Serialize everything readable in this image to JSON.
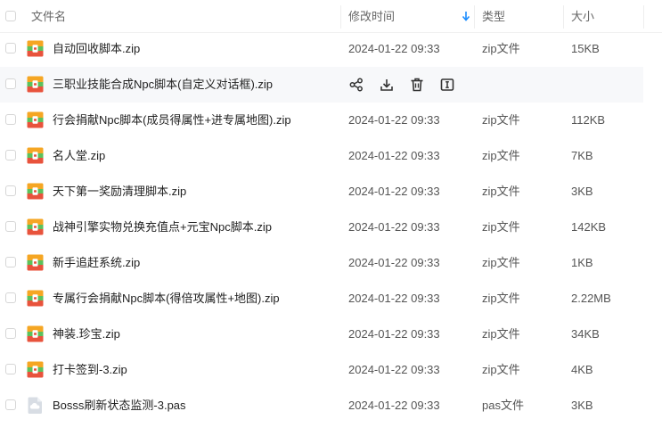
{
  "header": {
    "name_label": "文件名",
    "time_label": "修改时间",
    "type_label": "类型",
    "size_label": "大小"
  },
  "colors": {
    "accent": "#1a8cff",
    "zip_orange": "#f5a623",
    "zip_green": "#5cc15c",
    "zip_red": "#e8533c",
    "generic_gray": "#d8dde4"
  },
  "files": [
    {
      "name": "自动回收脚本.zip",
      "time": "2024-01-22 09:33",
      "type": "zip文件",
      "size": "15KB",
      "icon": "zip-file-icon"
    },
    {
      "name": "三职业技能合成Npc脚本(自定义对话框).zip",
      "time": "",
      "type": "",
      "size": "",
      "icon": "zip-file-icon",
      "hovered": true
    },
    {
      "name": "行会捐献Npc脚本(成员得属性+进专属地图).zip",
      "time": "2024-01-22 09:33",
      "type": "zip文件",
      "size": "112KB",
      "icon": "zip-file-icon"
    },
    {
      "name": "名人堂.zip",
      "time": "2024-01-22 09:33",
      "type": "zip文件",
      "size": "7KB",
      "icon": "zip-file-icon"
    },
    {
      "name": "天下第一奖励清理脚本.zip",
      "time": "2024-01-22 09:33",
      "type": "zip文件",
      "size": "3KB",
      "icon": "zip-file-icon"
    },
    {
      "name": "战神引擎实物兑换充值点+元宝Npc脚本.zip",
      "time": "2024-01-22 09:33",
      "type": "zip文件",
      "size": "142KB",
      "icon": "zip-file-icon"
    },
    {
      "name": "新手追赶系统.zip",
      "time": "2024-01-22 09:33",
      "type": "zip文件",
      "size": "1KB",
      "icon": "zip-file-icon"
    },
    {
      "name": "专属行会捐献Npc脚本(得倍攻属性+地图).zip",
      "time": "2024-01-22 09:33",
      "type": "zip文件",
      "size": "2.22MB",
      "icon": "zip-file-icon"
    },
    {
      "name": "神装.珍宝.zip",
      "time": "2024-01-22 09:33",
      "type": "zip文件",
      "size": "34KB",
      "icon": "zip-file-icon"
    },
    {
      "name": "打卡签到-3.zip",
      "time": "2024-01-22 09:33",
      "type": "zip文件",
      "size": "4KB",
      "icon": "zip-file-icon"
    },
    {
      "name": "Bosss刷新状态监测-3.pas",
      "time": "2024-01-22 09:33",
      "type": "pas文件",
      "size": "3KB",
      "icon": "generic-file-icon"
    }
  ],
  "row_actions": [
    "share-icon",
    "download-icon",
    "delete-icon",
    "rename-icon"
  ]
}
